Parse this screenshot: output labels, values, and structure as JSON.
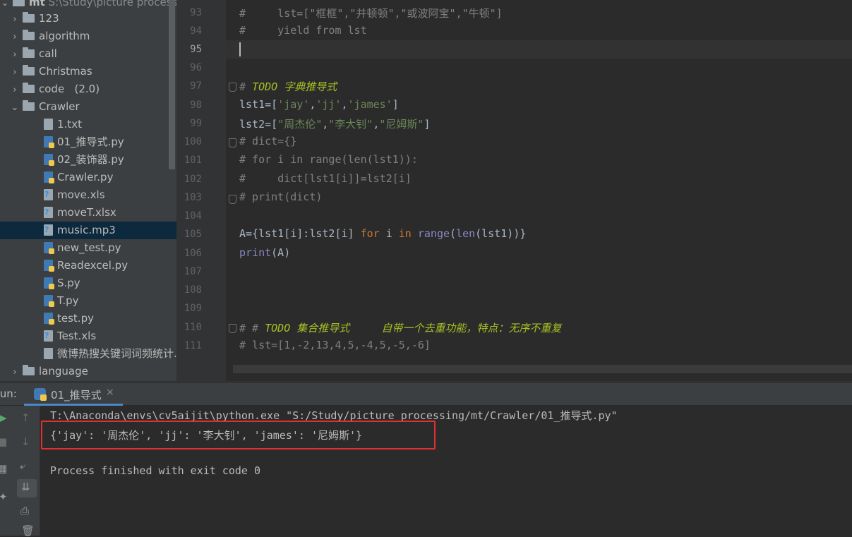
{
  "project": {
    "name": "mt",
    "path": "S:\\Study\\picture processi"
  },
  "tree": {
    "folders": [
      "123",
      "algorithm",
      "call",
      "Christmas",
      "code",
      "Crawler"
    ],
    "code_suffix": "(2.0)",
    "files": [
      {
        "name": "1.txt",
        "kind": "txt"
      },
      {
        "name": "01_推导式.py",
        "kind": "py"
      },
      {
        "name": "02_装饰器.py",
        "kind": "py"
      },
      {
        "name": "Crawler.py",
        "kind": "py"
      },
      {
        "name": "move.xls",
        "kind": "unknown"
      },
      {
        "name": "moveT.xlsx",
        "kind": "unknown"
      },
      {
        "name": "music.mp3",
        "kind": "unknown",
        "selected": true
      },
      {
        "name": "new_test.py",
        "kind": "py"
      },
      {
        "name": "Readexcel.py",
        "kind": "py"
      },
      {
        "name": "S.py",
        "kind": "py"
      },
      {
        "name": "T.py",
        "kind": "py"
      },
      {
        "name": "test.py",
        "kind": "py"
      },
      {
        "name": "Test.xls",
        "kind": "unknown"
      },
      {
        "name": "微博热搜关键词词频统计.",
        "kind": "txt"
      }
    ],
    "language": "language"
  },
  "editor": {
    "line_numbers": [
      "93",
      "94",
      "95",
      "96",
      "97",
      "98",
      "99",
      "100",
      "101",
      "102",
      "103",
      "104",
      "105",
      "106",
      "107",
      "108",
      "109",
      "110",
      "111"
    ],
    "lines": {
      "l93": "#     lst=[\"框框\",\"并顿顿\",\"或波阿宝\",\"牛顿\"]",
      "l94": "#     yield from lst",
      "l97_hash": "# ",
      "l97_todo": "TODO 字典推导式",
      "l98_a": "lst1=[",
      "l98_s1": "'jay'",
      "l98_c1": ",",
      "l98_s2": "'jj'",
      "l98_c2": ",",
      "l98_s3": "'james'",
      "l98_e": "]",
      "l99_a": "lst2=[",
      "l99_s1": "\"周杰伦\"",
      "l99_c1": ",",
      "l99_s2": "\"李大钊\"",
      "l99_c2": ",",
      "l99_s3": "\"尼姆斯\"",
      "l99_e": "]",
      "l100": "# dict={}",
      "l101": "# for i in range(len(lst1)):",
      "l102": "#     dict[lst1[i]]=lst2[i]",
      "l103": "# print(dict)",
      "l105_a": "A={lst1[i]:lst2[i] ",
      "l105_for": "for",
      "l105_b": " i ",
      "l105_in": "in",
      "l105_c": " ",
      "l105_range": "range",
      "l105_d": "(",
      "l105_len": "len",
      "l105_e": "(lst1))}",
      "l106_print": "print",
      "l106_rest": "(A)",
      "l110_hash": "# # ",
      "l110_todo": "TODO 集合推导式     自带一个去重功能，特点：无序不重复",
      "l111": "# lst=[1,-2,13,4,5,-4,5,-5,-6]"
    }
  },
  "run": {
    "label": "Run:",
    "tab_title": "01_推导式",
    "close": "×",
    "cmd": "T:\\Anaconda\\envs\\cv5aijit\\python.exe \"S:/Study/picture processing/mt/Crawler/01_推导式.py\"",
    "output": "{'jay': '周杰伦', 'jj': '李大钊', 'james': '尼姆斯'}",
    "finish": "Process finished with exit code 0"
  }
}
